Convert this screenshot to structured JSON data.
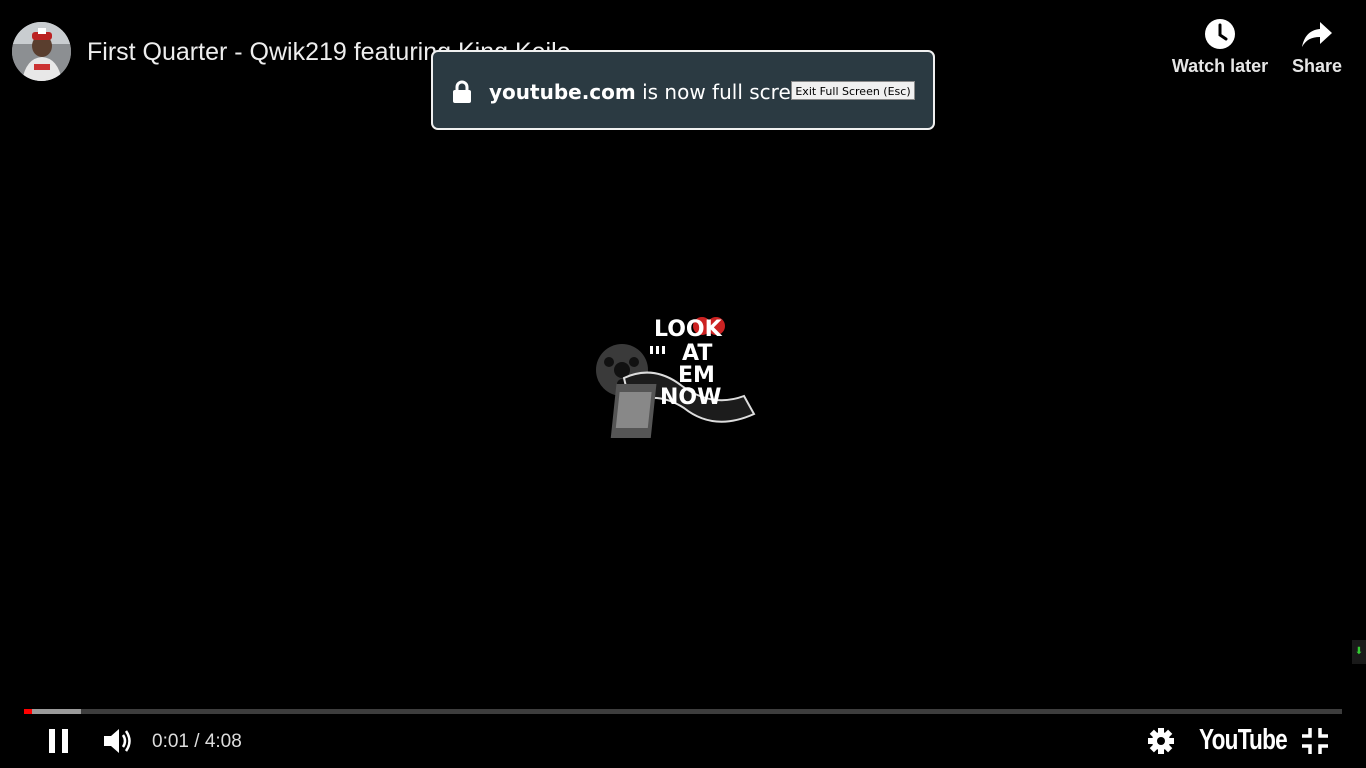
{
  "video": {
    "title": "First Quarter - Qwik219 featuring King Keilo",
    "channel_avatar_icon": "channel-avatar"
  },
  "top_actions": {
    "watch_later_label": "Watch later",
    "watch_later_icon": "clock-icon",
    "share_label": "Share",
    "share_icon": "share-arrow-icon"
  },
  "fullscreen_notice": {
    "domain": "youtube.com",
    "message": "is now full screen",
    "exit_button_label": "Exit Full Screen (Esc)",
    "lock_icon": "lock-icon"
  },
  "logo": {
    "text_lines": [
      "LOOK",
      "AT",
      "EM",
      "NOW"
    ]
  },
  "player": {
    "current_time": "0:01",
    "separator": " / ",
    "duration": "4:08",
    "played_fraction": 0.004,
    "buffered_fraction": 0.043,
    "brand_label": "YouTube",
    "accent_color": "#ff0000",
    "buffer_color": "#9a9a9a",
    "track_color": "#3d3d3d",
    "state": "playing"
  }
}
